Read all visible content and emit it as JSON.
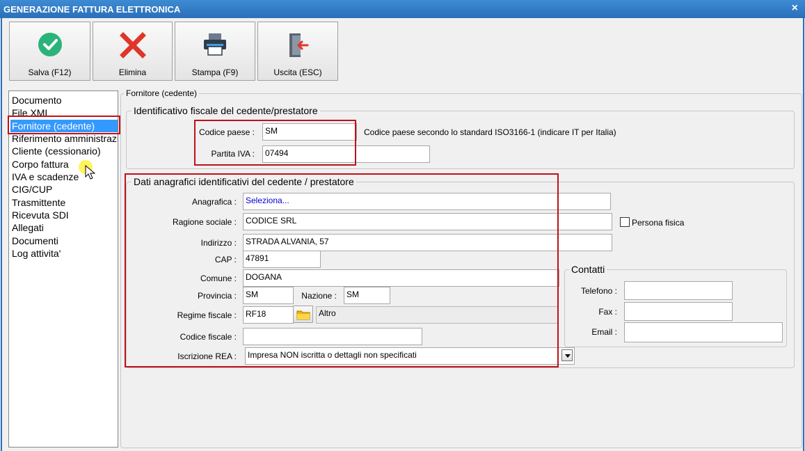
{
  "window": {
    "title": "GENERAZIONE FATTURA ELETTRONICA",
    "close_glyph": "×"
  },
  "toolbar": {
    "save_label": "Salva (F12)",
    "delete_label": "Elimina",
    "print_label": "Stampa (F9)",
    "exit_label": "Uscita (ESC)"
  },
  "nav": {
    "items": [
      {
        "label": "Documento"
      },
      {
        "label": "File XML"
      },
      {
        "label": "Fornitore (cedente)"
      },
      {
        "label": "Riferimento amministrazione"
      },
      {
        "label": "Cliente (cessionario)"
      },
      {
        "label": "Corpo fattura"
      },
      {
        "label": "IVA e scadenze"
      },
      {
        "label": "CIG/CUP"
      },
      {
        "label": "Trasmittente"
      },
      {
        "label": "Ricevuta SDI"
      },
      {
        "label": "Allegati"
      },
      {
        "label": "Documenti"
      },
      {
        "label": "Log attivita'"
      }
    ],
    "selected_index": 2
  },
  "main": {
    "panel_title": "Fornitore (cedente)",
    "fiscal_group": {
      "title": "Identificativo fiscale del cedente/prestatore",
      "country_label": "Codice paese :",
      "country_value": "SM",
      "country_hint": "Codice paese secondo lo standard ISO3166-1 (indicare IT per Italia)",
      "vat_label": "Partita IVA :",
      "vat_value": "07494"
    },
    "registry_group": {
      "title": "Dati anagrafici identificativi del cedente / prestatore",
      "anagrafica_label": "Anagrafica :",
      "anagrafica_value": "Seleziona...",
      "ragione_label": "Ragione sociale :",
      "ragione_value": "CODICE SRL",
      "persona_fisica_label": "Persona fisica",
      "persona_fisica_checked": false,
      "indirizzo_label": "Indirizzo :",
      "indirizzo_value": "STRADA ALVANIA, 57",
      "cap_label": "CAP :",
      "cap_value": "47891",
      "comune_label": "Comune :",
      "comune_value": "DOGANA",
      "provincia_label": "Provincia :",
      "provincia_value": "SM",
      "nazione_label": "Nazione :",
      "nazione_value": "SM",
      "regime_label": "Regime fiscale :",
      "regime_value": "RF18",
      "regime_desc": "Altro",
      "codice_fiscale_label": "Codice fiscale :",
      "codice_fiscale_value": "",
      "rea_label": "Iscrizione REA :",
      "rea_value": "Impresa NON iscritta o dettagli non specificati"
    },
    "contacts_group": {
      "title": "Contatti",
      "telefono_label": "Telefono :",
      "telefono_value": "",
      "fax_label": "Fax :",
      "fax_value": "",
      "email_label": "Email :",
      "email_value": ""
    }
  },
  "colors": {
    "accent": "#3399ff",
    "highlight_red": "#c0101a",
    "title_blue": "#2a6fb8",
    "link_blue": "#0000cc"
  },
  "icons": {
    "save": "check-circle-icon",
    "delete": "red-x-icon",
    "print": "printer-icon",
    "exit": "door-exit-icon",
    "regime_picker": "folder-icon"
  }
}
